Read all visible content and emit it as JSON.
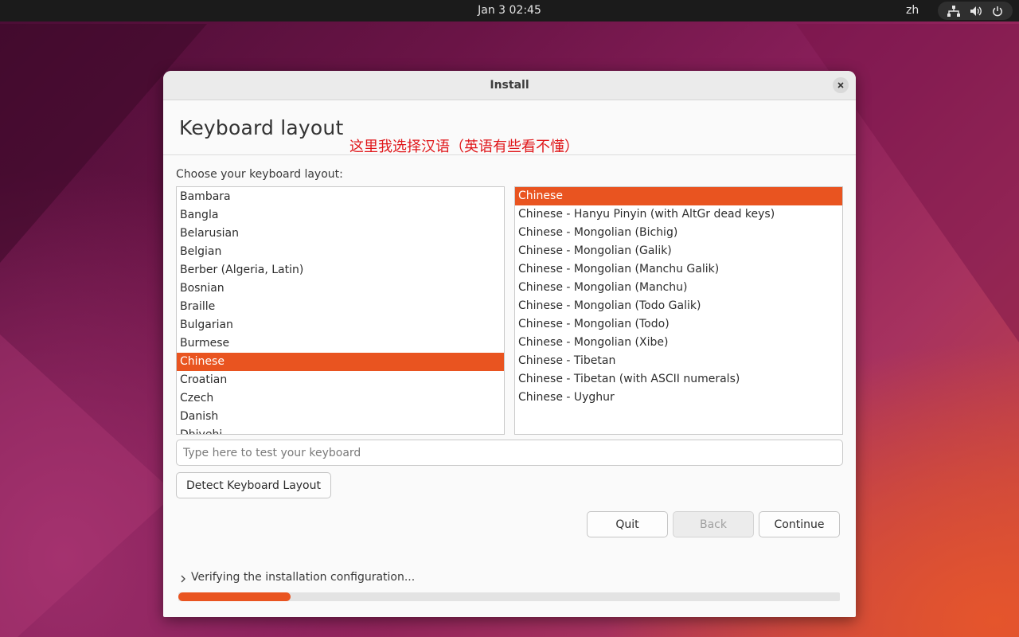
{
  "topbar": {
    "clock": "Jan 3  02:45",
    "input_language": "zh",
    "tray_icons": [
      "network-icon",
      "volume-icon",
      "power-icon"
    ]
  },
  "window": {
    "title": "Install",
    "page_title": "Keyboard layout",
    "annotation": "这里我选择汉语（英语有些看不懂）",
    "choose_label": "Choose your keyboard layout:",
    "layouts": [
      {
        "label": "Bambara",
        "selected": false
      },
      {
        "label": "Bangla",
        "selected": false
      },
      {
        "label": "Belarusian",
        "selected": false
      },
      {
        "label": "Belgian",
        "selected": false
      },
      {
        "label": "Berber (Algeria, Latin)",
        "selected": false
      },
      {
        "label": "Bosnian",
        "selected": false
      },
      {
        "label": "Braille",
        "selected": false
      },
      {
        "label": "Bulgarian",
        "selected": false
      },
      {
        "label": "Burmese",
        "selected": false
      },
      {
        "label": "Chinese",
        "selected": true
      },
      {
        "label": "Croatian",
        "selected": false
      },
      {
        "label": "Czech",
        "selected": false
      },
      {
        "label": "Danish",
        "selected": false
      },
      {
        "label": "Dhivehi",
        "selected": false
      }
    ],
    "variants": [
      {
        "label": "Chinese",
        "selected": true
      },
      {
        "label": "Chinese - Hanyu Pinyin (with AltGr dead keys)",
        "selected": false
      },
      {
        "label": "Chinese - Mongolian (Bichig)",
        "selected": false
      },
      {
        "label": "Chinese - Mongolian (Galik)",
        "selected": false
      },
      {
        "label": "Chinese - Mongolian (Manchu Galik)",
        "selected": false
      },
      {
        "label": "Chinese - Mongolian (Manchu)",
        "selected": false
      },
      {
        "label": "Chinese - Mongolian (Todo Galik)",
        "selected": false
      },
      {
        "label": "Chinese - Mongolian (Todo)",
        "selected": false
      },
      {
        "label": "Chinese - Mongolian (Xibe)",
        "selected": false
      },
      {
        "label": "Chinese - Tibetan",
        "selected": false
      },
      {
        "label": "Chinese - Tibetan (with ASCII numerals)",
        "selected": false
      },
      {
        "label": "Chinese - Uyghur",
        "selected": false
      }
    ],
    "test_input": {
      "value": "",
      "placeholder": "Type here to test your keyboard"
    },
    "detect_button": "Detect Keyboard Layout",
    "quit_button": "Quit",
    "back_button": "Back",
    "back_enabled": false,
    "continue_button": "Continue",
    "status_text": "Verifying the installation configuration...",
    "progress": 0.17
  },
  "colors": {
    "accent": "#e95420",
    "annotation": "#e0171a"
  }
}
